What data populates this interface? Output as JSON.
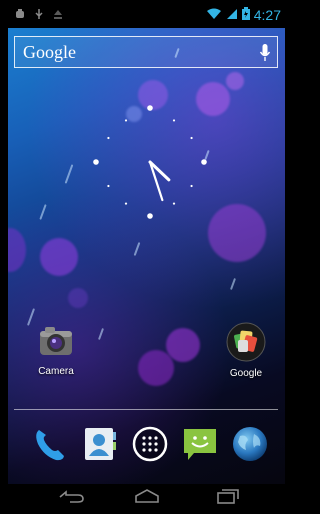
{
  "status_bar": {
    "time": "4:27",
    "icons": [
      "android-debug-icon",
      "usb-icon",
      "upload-icon",
      "wifi-icon",
      "signal-icon",
      "battery-icon"
    ]
  },
  "search_widget": {
    "label": "Google",
    "icon": "mic-icon"
  },
  "clock": {
    "hour": 4,
    "minute": 27
  },
  "apps": [
    {
      "label": "Camera",
      "icon": "camera-icon"
    },
    {
      "label": "Google",
      "icon": "google-folder-icon"
    }
  ],
  "dock": [
    {
      "icon": "phone-icon"
    },
    {
      "icon": "contacts-icon"
    },
    {
      "icon": "app-drawer-icon"
    },
    {
      "icon": "messaging-icon"
    },
    {
      "icon": "browser-icon"
    }
  ],
  "nav_bar": {
    "icons": [
      "back-icon",
      "home-icon",
      "recents-icon"
    ]
  },
  "colors": {
    "status_accent": "#33b5e5",
    "wallpaper_top": "#1b7fd0",
    "wallpaper_bottom": "#06060f"
  }
}
